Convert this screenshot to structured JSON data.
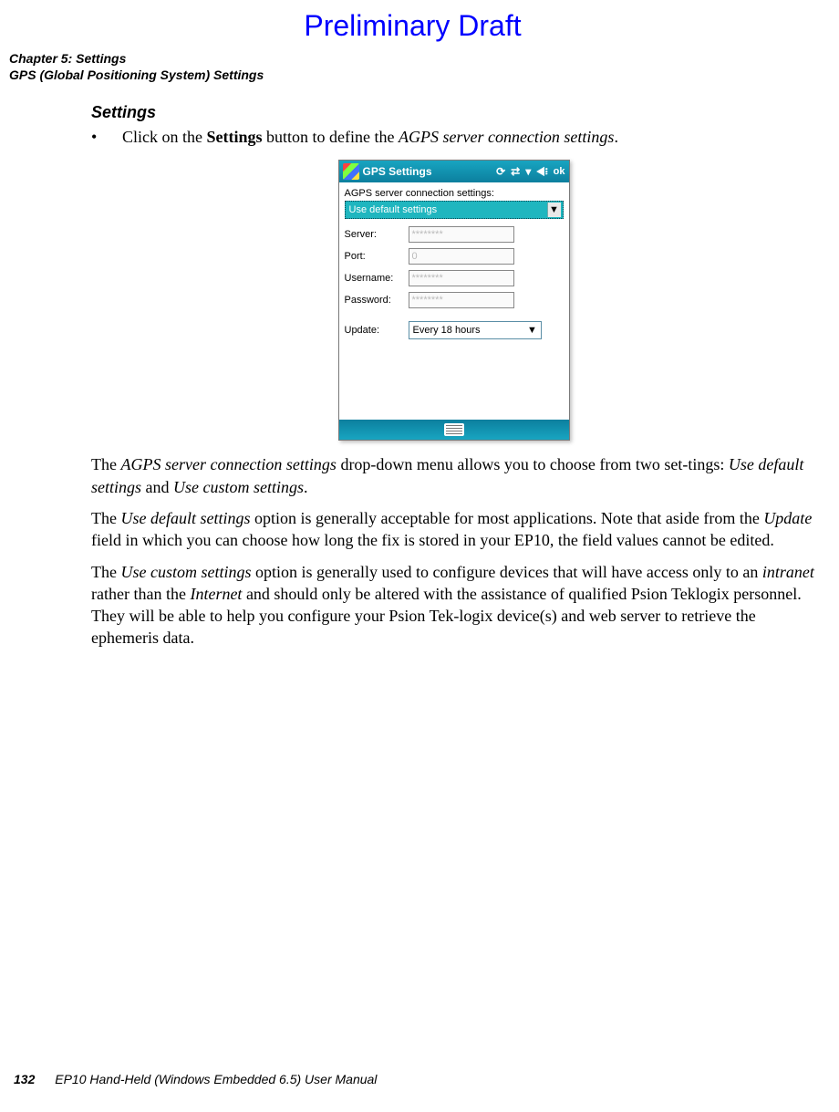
{
  "banner": "Preliminary Draft",
  "header": {
    "chapter": "Chapter 5: Settings",
    "section": "GPS (Global Positioning System) Settings"
  },
  "body": {
    "heading": "Settings",
    "bullet_pre": "Click on the ",
    "bullet_bold": "Settings",
    "bullet_mid": " button to define the ",
    "bullet_italic": "AGPS server connection settings",
    "bullet_end": ".",
    "p1a": "The ",
    "p1i1": "AGPS server connection settings",
    "p1b": " drop-down menu allows you to choose from two set-tings: ",
    "p1i2": "Use default settings",
    "p1c": " and ",
    "p1i3": "Use custom settings",
    "p1d": ".",
    "p2a": "The ",
    "p2i1": "Use default settings",
    "p2b": " option is generally acceptable for most applications. Note that aside from the ",
    "p2i2": "Update",
    "p2c": " field in which you can choose how long the fix is stored in your EP10, the field values cannot be edited.",
    "p3a": "The ",
    "p3i1": "Use custom settings",
    "p3b": " option is generally used to configure devices that will have access only to an ",
    "p3i2": "intranet",
    "p3c": " rather than the ",
    "p3i3": "Internet",
    "p3d": " and should only be altered with the assistance of qualified Psion Teklogix personnel. They will be able to help you configure your Psion Tek-logix device(s) and web server to retrieve the ephemeris data."
  },
  "device": {
    "title": "GPS Settings",
    "ok": "ok",
    "connection_label": "AGPS server connection settings:",
    "connection_value": "Use default settings",
    "fields": {
      "server_label": "Server:",
      "server_value": "********",
      "port_label": "Port:",
      "port_value": "0",
      "username_label": "Username:",
      "username_value": "********",
      "password_label": "Password:",
      "password_value": "********",
      "update_label": "Update:",
      "update_value": "Every 18 hours"
    }
  },
  "footer": {
    "page": "132",
    "title": "EP10 Hand-Held (Windows Embedded 6.5) User Manual"
  }
}
